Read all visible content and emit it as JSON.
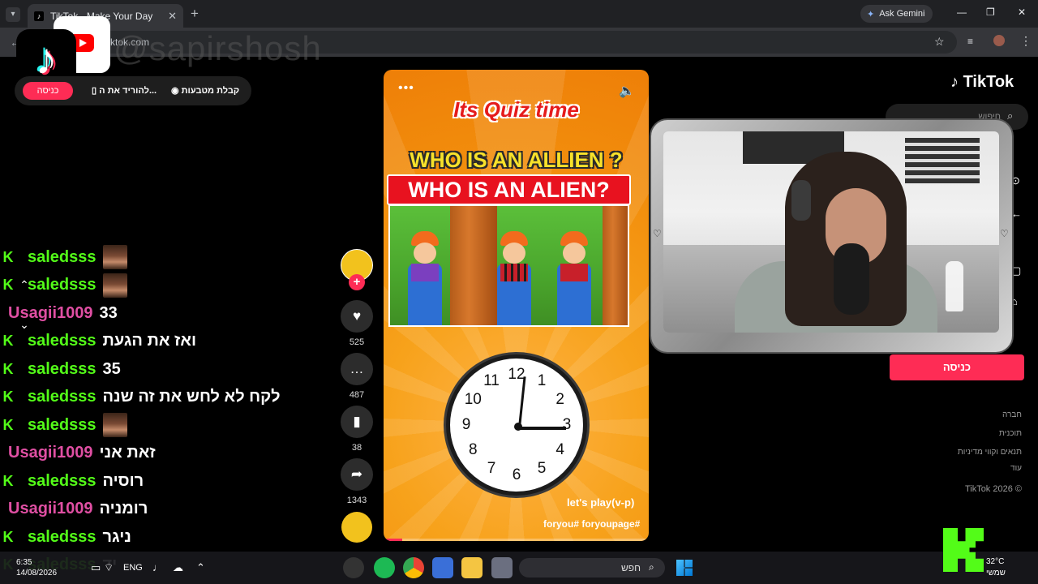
{
  "browser": {
    "tab_title": "TikTok - Make Your Day",
    "tab_favicon": "tiktok-icon",
    "new_tab": "+",
    "gemini_label": "Ask Gemini",
    "url": "tiktok.com",
    "min": "—",
    "max": "❐",
    "close": "✕"
  },
  "overlay": {
    "handle": "@sapirshosh"
  },
  "tiktok_top": {
    "login_small": "כניסה",
    "download": "להוריד את ה...",
    "coins": "קבלת מטבעות"
  },
  "chat": [
    {
      "platform": "K",
      "user": "saledsss",
      "text": "",
      "emote": true,
      "ucolor": "k"
    },
    {
      "platform": "K",
      "user": "saledsss",
      "text": "",
      "emote": true,
      "ucolor": "k"
    },
    {
      "platform": "",
      "user": "Usagii1009",
      "text": "33",
      "emote": false,
      "ucolor": "u"
    },
    {
      "platform": "K",
      "user": "saledsss",
      "text": "ואז את הגעת",
      "emote": false,
      "ucolor": "k"
    },
    {
      "platform": "K",
      "user": "saledsss",
      "text": "35",
      "emote": false,
      "ucolor": "k"
    },
    {
      "platform": "K",
      "user": "saledsss",
      "text": "לקח לא לחש את זה שנה",
      "emote": false,
      "ucolor": "k"
    },
    {
      "platform": "K",
      "user": "saledsss",
      "text": "",
      "emote": true,
      "ucolor": "k"
    },
    {
      "platform": "",
      "user": "Usagii1009",
      "text": "זאת אני",
      "emote": false,
      "ucolor": "u"
    },
    {
      "platform": "K",
      "user": "saledsss",
      "text": "רוסיה",
      "emote": false,
      "ucolor": "k"
    },
    {
      "platform": "",
      "user": "Usagii1009",
      "text": "רומניה",
      "emote": false,
      "ucolor": "u"
    },
    {
      "platform": "K",
      "user": "saledsss",
      "text": "ניגר",
      "emote": false,
      "ucolor": "k"
    },
    {
      "platform": "K",
      "user": "saledsss",
      "text": "יד",
      "emote": false,
      "ucolor": "k"
    }
  ],
  "video": {
    "quiz_title": "Its Quiz time",
    "question_yellow": "WHO IS AN ALLIEN ?",
    "question_banner": "WHO IS AN ALIEN?",
    "clock_numbers": [
      "12",
      "1",
      "2",
      "3",
      "4",
      "5",
      "6",
      "7",
      "8",
      "9",
      "10",
      "11"
    ],
    "caption": "let's play(v-p)",
    "hashtags": "foryou# foryoupage#",
    "progress": 0.07
  },
  "actions": {
    "likes": "525",
    "comments": "487",
    "saves": "38",
    "shares": "1343",
    "follow": "+"
  },
  "right": {
    "brand": "TikTok",
    "search_placeholder": "חיפוש",
    "login": "כניסה",
    "links": [
      "חברה",
      "תוכנית",
      "תנאים וקווי מדיניות",
      "עוד"
    ],
    "copyright": "TikTok 2026 ©"
  },
  "taskbar": {
    "time": "6:35",
    "date": "14/08/2026",
    "lang": "ENG",
    "search": "חפש",
    "temp": "32°C",
    "weather": "שמשי"
  },
  "colors": {
    "tiktok_red": "#fe2c55",
    "kick_green": "#53fc18",
    "usagi_pink": "#e04fa3",
    "video_orange": "#f28d0c"
  }
}
